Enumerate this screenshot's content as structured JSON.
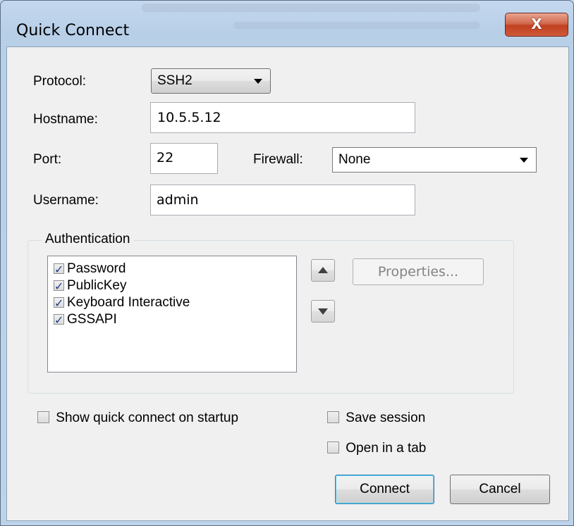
{
  "dialog": {
    "title": "Quick Connect",
    "close_label": "X"
  },
  "form": {
    "protocol_label": "Protocol:",
    "protocol_value": "SSH2",
    "hostname_label": "Hostname:",
    "hostname_value": "10.5.5.12",
    "port_label": "Port:",
    "port_value": "22",
    "firewall_label": "Firewall:",
    "firewall_value": "None",
    "username_label": "Username:",
    "username_value": "admin"
  },
  "authentication": {
    "group_label": "Authentication",
    "methods": [
      {
        "label": "Password",
        "checked": true
      },
      {
        "label": "PublicKey",
        "checked": true
      },
      {
        "label": "Keyboard Interactive",
        "checked": true
      },
      {
        "label": "GSSAPI",
        "checked": true
      }
    ],
    "properties_label": "Properties..."
  },
  "options": {
    "show_on_startup_label": "Show quick connect on startup",
    "show_on_startup_checked": false,
    "save_session_label": "Save session",
    "save_session_checked": false,
    "open_in_tab_label": "Open in a tab",
    "open_in_tab_checked": false
  },
  "buttons": {
    "connect_label": "Connect",
    "cancel_label": "Cancel"
  },
  "icons": {
    "close": "close-icon",
    "move_up": "arrow-up-icon",
    "move_down": "arrow-down-icon",
    "dropdown": "chevron-down-icon"
  },
  "colors": {
    "close_button": "#c1401f",
    "frame": "#bdd3ea",
    "client_bg": "#f0f0f0",
    "checkmark": "#1f3c88"
  }
}
